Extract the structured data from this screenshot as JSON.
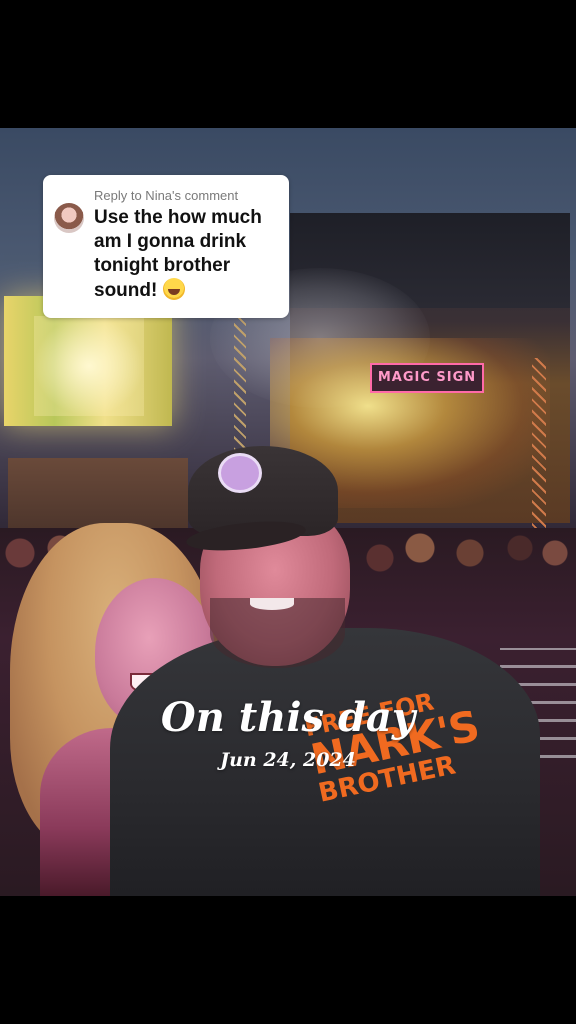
{
  "reply": {
    "header": "Reply to Nina's comment",
    "comment_text": "Use the how much am I gonna drink tonight brother sound!",
    "emoji": "face-with-tears-of-joy"
  },
  "memory": {
    "title": "On this day",
    "date": "Jun 24, 2024"
  },
  "scene": {
    "stage_sign_text": "MAGIC SIGN",
    "shirt_line1": "FREE FOR",
    "shirt_line2": "NARK'S",
    "shirt_line3": "BROTHER"
  },
  "colors": {
    "card_bg": "#ffffff",
    "header_gray": "#7a7a7a",
    "shirt_print": "#f06a20",
    "letterbox": "#000000"
  }
}
